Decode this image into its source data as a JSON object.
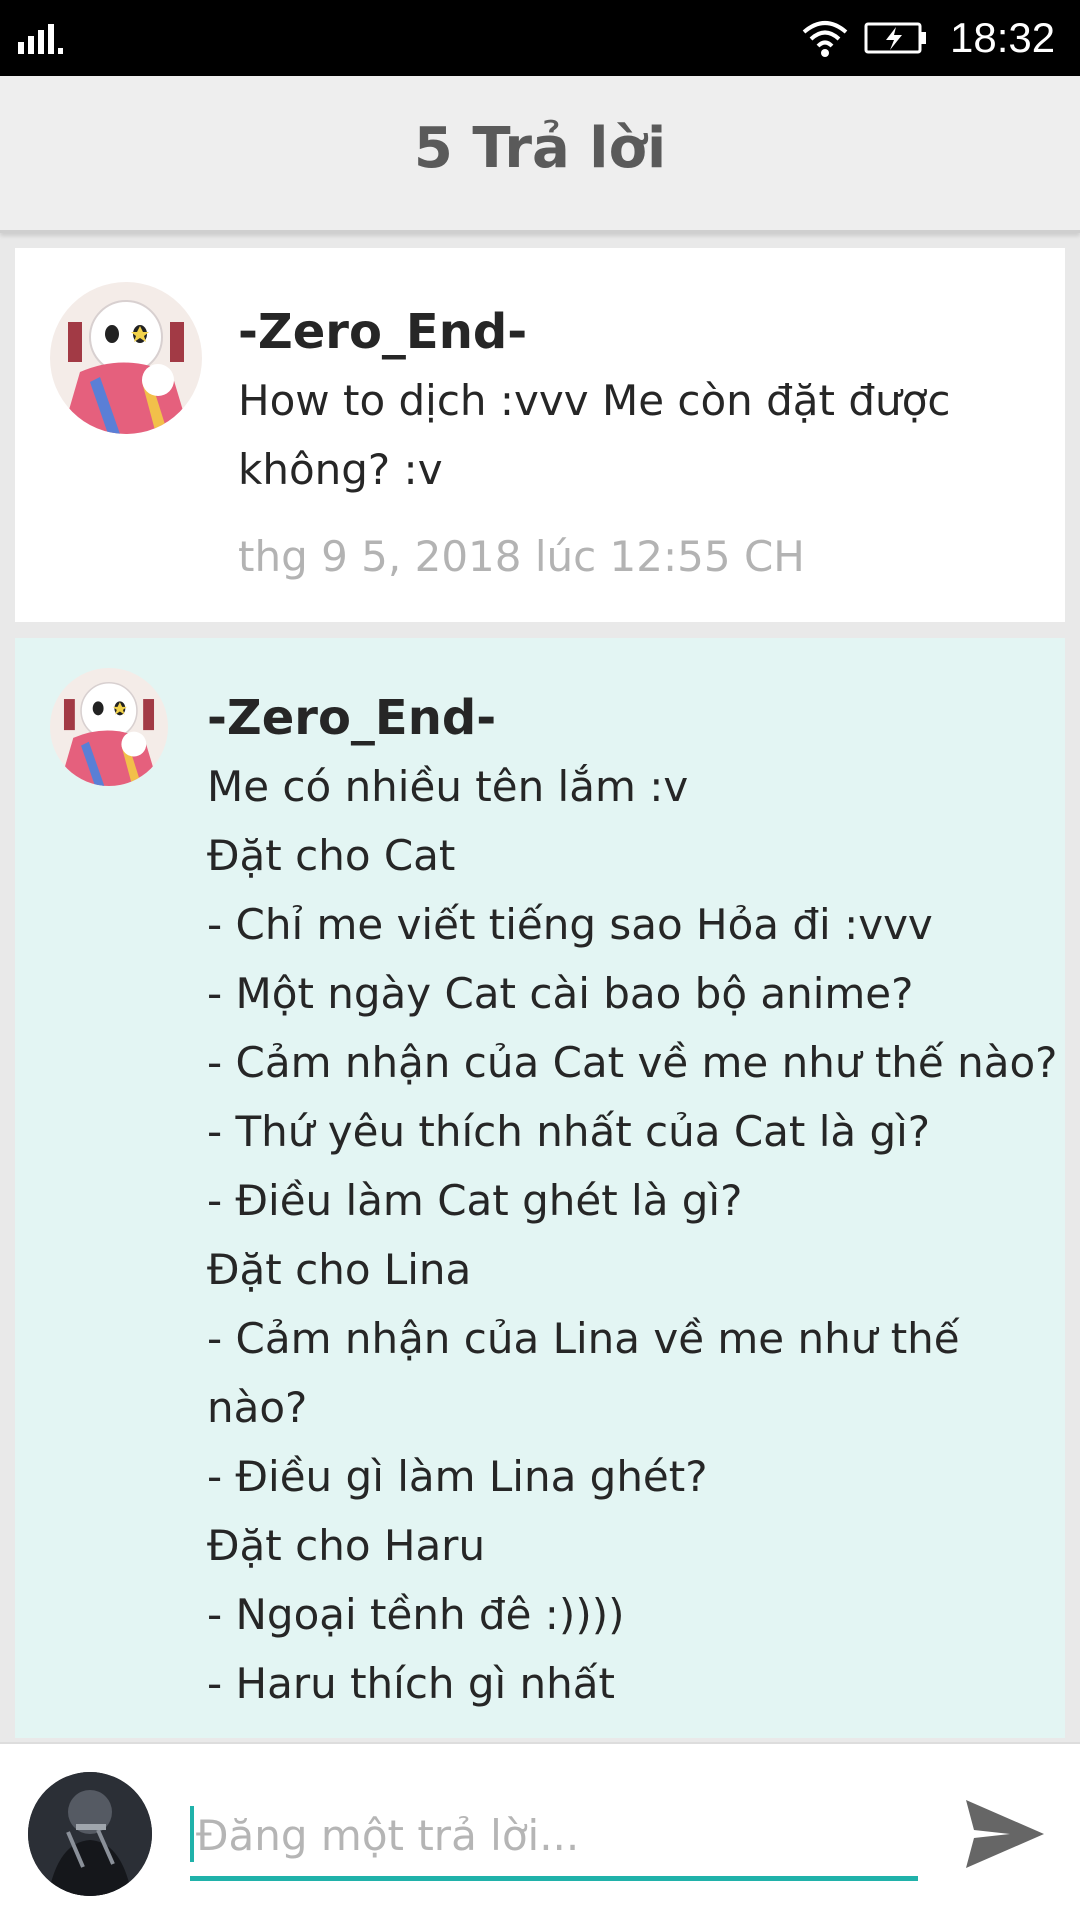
{
  "status_bar": {
    "time": "18:32",
    "icons": [
      "signal-icon",
      "wifi-icon",
      "battery-charging-icon"
    ]
  },
  "header": {
    "title": "5 Trả lời"
  },
  "comments": [
    {
      "author": "-Zero_End-",
      "text_lines": [
        "How to dịch :vvv Me còn đặt được",
        "không? :v"
      ],
      "timestamp": "thg 9 5, 2018 lúc 12:55 CH"
    },
    {
      "author": "-Zero_End-",
      "text_lines": [
        "Me có nhiều tên lắm :v",
        "Đặt cho Cat",
        "- Chỉ me viết tiếng sao Hỏa đi :vvv",
        "- Một ngày Cat cài bao bộ anime?",
        "- Cảm nhận của Cat về me như thế nào?",
        "- Thứ yêu thích nhất của Cat là gì?",
        "- Điều làm Cat ghét là gì?",
        "Đặt cho Lina",
        "- Cảm nhận của Lina về me như thế",
        "nào?",
        "- Điều gì làm Lina ghét?",
        "Đặt cho Haru",
        "- Ngoại tềnh đê :))))",
        "- Haru thích gì nhất"
      ]
    }
  ],
  "reply": {
    "placeholder": "Đăng một trả lời..."
  },
  "colors": {
    "accent": "#20b2aa",
    "highlight_background": "#e3f5f3",
    "header_background": "#eeeeee"
  }
}
